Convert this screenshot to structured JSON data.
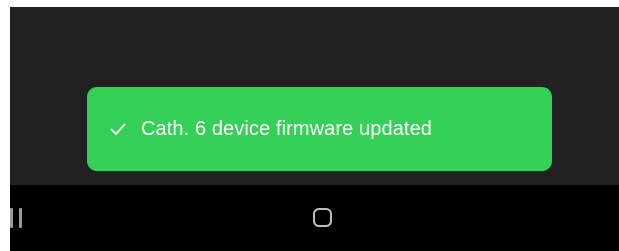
{
  "toast": {
    "message": "Cath. 6 device firmware updated",
    "icon": "check-icon",
    "background_color": "#34d058",
    "text_color": "#ffffff"
  },
  "nav_bar": {
    "recents_icon": "recents-icon",
    "home_icon": "home-icon"
  },
  "colors": {
    "app_background": "#212121",
    "nav_background": "#000000"
  }
}
